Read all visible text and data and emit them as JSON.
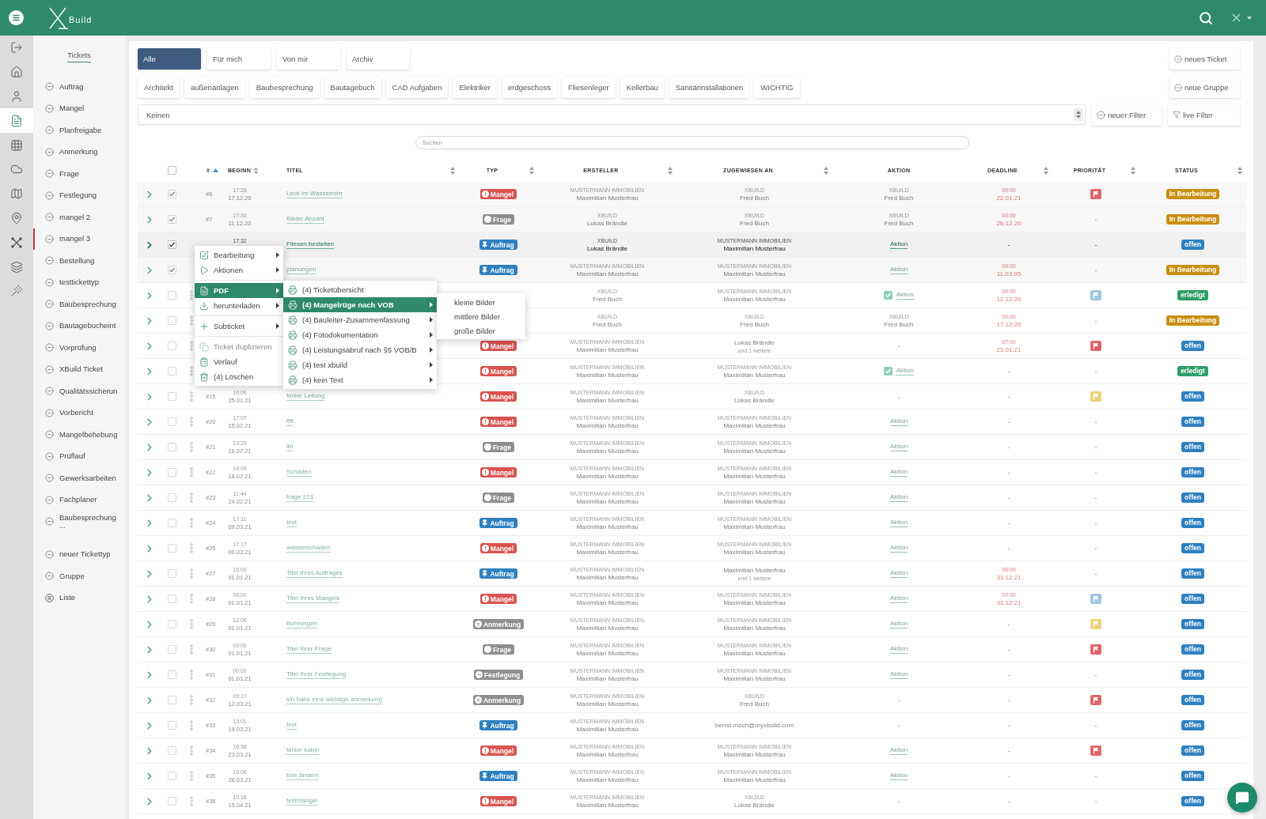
{
  "app_bar": {
    "brand": "Build"
  },
  "rail": [
    {
      "kind": "exit",
      "selected": false
    },
    {
      "kind": "home",
      "selected": false
    },
    {
      "kind": "user",
      "selected": false
    },
    {
      "kind": "document",
      "selected": true
    },
    {
      "kind": "grid",
      "selected": false
    },
    {
      "kind": "cloud",
      "selected": false
    },
    {
      "kind": "map",
      "selected": false
    },
    {
      "kind": "pin",
      "selected": false
    },
    {
      "kind": "network",
      "selected": false
    },
    {
      "kind": "layers",
      "selected": false
    },
    {
      "kind": "wand",
      "selected": false
    }
  ],
  "sidebar": {
    "title": "Tickets",
    "items": [
      {
        "label": "Auftrag",
        "selected": false
      },
      {
        "label": "Mangel",
        "selected": false
      },
      {
        "label": "Planfreigabe",
        "selected": false
      },
      {
        "label": "Anmerkung",
        "selected": false
      },
      {
        "label": "Frage",
        "selected": false
      },
      {
        "label": "Festlegung",
        "selected": false
      },
      {
        "label": "mangel 2",
        "selected": false
      },
      {
        "label": "mangel 3",
        "selected": true
      },
      {
        "label": "Bestellung",
        "selected": false
      },
      {
        "label": "testtickettyp",
        "selected": false
      },
      {
        "label": "Baubesprechung",
        "selected": false
      },
      {
        "label": "Bautagebucheint",
        "selected": false
      },
      {
        "label": "Vorprüfung",
        "selected": false
      },
      {
        "label": "XBuild Ticket",
        "selected": false
      },
      {
        "label": "Qualitätssicherun",
        "selected": false
      },
      {
        "label": "Vorbericht",
        "selected": false
      },
      {
        "label": "Mangelbehebung",
        "selected": false
      },
      {
        "label": "Prüflauf",
        "selected": false
      },
      {
        "label": "Gewerksarbeiten",
        "selected": false
      },
      {
        "label": "Fachplaner",
        "selected": false
      },
      {
        "label": "Baubesprechung ...",
        "selected": false
      }
    ],
    "actions": [
      {
        "label": "neuer Tickettyp",
        "kind": "add"
      },
      {
        "label": "Gruppe",
        "kind": "add"
      },
      {
        "label": "Liste",
        "kind": "list"
      }
    ]
  },
  "tabs": [
    {
      "label": "Alle",
      "selected": true
    },
    {
      "label": "Für mich",
      "selected": false
    },
    {
      "label": "Von mir",
      "selected": false
    },
    {
      "label": "Archiv",
      "selected": false
    }
  ],
  "new_ticket_button": {
    "label": "neues Ticket"
  },
  "groups": [
    "Architekt",
    "außenanlagen",
    "Baubesprechung",
    "Bautagebuch",
    "CAD Aufgaben",
    "Elektriker",
    "erdgeschoss",
    "Fliesenleger",
    "Kellerbau",
    "Sanitärinstallationen",
    "WICHTIG"
  ],
  "new_group_button": {
    "label": "neue Gruppe"
  },
  "filter": {
    "value": "Keinen"
  },
  "filter_buttons": [
    {
      "label": "neuer Filter",
      "kind": "add"
    },
    {
      "label": "live Filter",
      "kind": "filter"
    }
  ],
  "search": {
    "placeholder": "Suchen"
  },
  "table": {
    "select_all": {
      "checked": false
    },
    "columns": [
      {
        "label": "#",
        "sortable": true,
        "sorted": true
      },
      {
        "label": "BEGINN",
        "sortable": true,
        "sorted": false
      },
      {
        "label": "TITEL",
        "sortable": true,
        "sorted": false
      },
      {
        "label": "TYP",
        "sortable": true,
        "sorted": false
      },
      {
        "label": "ERSTELLER",
        "sortable": true,
        "sorted": false
      },
      {
        "label": "ZUGEWIESEN AN",
        "sortable": true,
        "sorted": false
      },
      {
        "label": "AKTION",
        "sortable": false,
        "sorted": false
      },
      {
        "label": "DEADLINE",
        "sortable": true,
        "sorted": false
      },
      {
        "label": "PRIORITÄT",
        "sortable": true,
        "sorted": false
      },
      {
        "label": "STATUS",
        "sortable": true,
        "sorted": false
      }
    ],
    "rows": [
      {
        "checked": true,
        "active": false,
        "number": "#6",
        "start": {
          "time": "17:26",
          "date": "17.12.20"
        },
        "title": "Leck im Wasserrohr",
        "type": {
          "label": "Mangel",
          "kind": "mangel"
        },
        "creator": {
          "org": "MUSTERMANN IMMOBILIEN",
          "name": "Maximilian Musterfrau"
        },
        "assignee": {
          "org": "XBUILD",
          "name": "Fred Buch"
        },
        "action": {
          "kind": "person",
          "org": "XBUILD",
          "name": "Fred Buch"
        },
        "deadline": {
          "time": "00:00",
          "date": "22.01.21"
        },
        "priority": {
          "kind": "flag",
          "color": "#e06666"
        },
        "status": {
          "label": "In Bearbeitung",
          "kind": "progress"
        }
      },
      {
        "checked": true,
        "active": false,
        "number": "#7",
        "start": {
          "time": "17:30",
          "date": "11.12.20"
        },
        "title": "Bäder Anzahl",
        "type": {
          "label": "Frage",
          "kind": "frage"
        },
        "creator": {
          "org": "XBUILD",
          "name": "Lukas Brändle"
        },
        "assignee": {
          "org": "XBUILD",
          "name": "Fred Buch"
        },
        "action": {
          "kind": "person",
          "org": "XBUILD",
          "name": "Fred Buch"
        },
        "deadline": {
          "time": "00:00",
          "date": "26.12.20"
        },
        "priority": {
          "kind": "none",
          "text": "-"
        },
        "status": {
          "label": "In Bearbeitung",
          "kind": "progress"
        }
      },
      {
        "checked": true,
        "active": true,
        "start": {
          "time": "17:32"
        },
        "title": "Fliesen bestellen",
        "type": {
          "label": "Auftrag",
          "kind": "auftrag"
        },
        "creator": {
          "org": "XBUILD",
          "name": "Lukas Brändle"
        },
        "assignee": {
          "org": "MUSTERMANN IMMOBILIEN",
          "name": "Maximilian Musterfrau"
        },
        "action": {
          "kind": "link",
          "text": "Aktion",
          "done": false
        },
        "deadline": {
          "text": "-"
        },
        "priority": {
          "kind": "none",
          "text": "-"
        },
        "status": {
          "label": "offen",
          "kind": "open"
        }
      },
      {
        "checked": true,
        "active": false,
        "title": "planungen",
        "type": {
          "label": "Auftrag",
          "kind": "auftrag"
        },
        "creator": {
          "org": "MUSTERMANN IMMOBILIEN",
          "name": "Maximilian Musterfrau"
        },
        "assignee": {
          "org": "MUSTERMANN IMMOBILIEN",
          "name": "Maximilian Musterfrau"
        },
        "action": {
          "kind": "link",
          "text": "Aktion",
          "done": false
        },
        "deadline": {
          "time": "09:00",
          "date": "11.03.95"
        },
        "priority": {
          "kind": "none",
          "text": "-"
        },
        "status": {
          "label": "In Bearbeitung",
          "kind": "progress"
        }
      },
      {
        "checked": false,
        "active": false,
        "creator": {
          "org": "XBUILD",
          "name": "Fred Buch"
        },
        "assignee": {
          "org": "MUSTERMANN IMMOBILIEN",
          "name": "Maximilian Musterfrau"
        },
        "action": {
          "kind": "link",
          "text": "Aktion",
          "done": true
        },
        "deadline": {
          "time": "00:00",
          "date": "12.12.20"
        },
        "priority": {
          "kind": "flag",
          "color": "#9fc8e3"
        },
        "status": {
          "label": "erledigt",
          "kind": "done"
        }
      },
      {
        "checked": false,
        "active": false,
        "creator": {
          "org": "XBUILD",
          "name": "Fred Buch"
        },
        "assignee": {
          "org": "XBUILD",
          "name": "Fred Buch"
        },
        "action": {
          "kind": "person",
          "org": "XBUILD",
          "name": "Fred Buch"
        },
        "deadline": {
          "time": "00:00",
          "date": "17.12.20"
        },
        "priority": {
          "kind": "none",
          "text": "-"
        },
        "status": {
          "label": "In Bearbeitung",
          "kind": "progress"
        }
      },
      {
        "checked": false,
        "active": false,
        "type": {
          "label": "Mangel",
          "kind": "mangel"
        },
        "creator": {
          "org": "MUSTERMANN IMMOBILIEN",
          "name": "Maximilian Musterfrau"
        },
        "assignee": {
          "name": "Lukas Brändle",
          "more": "und 1 weitere"
        },
        "action": {
          "kind": "dash",
          "text": "-"
        },
        "deadline": {
          "time": "07:00",
          "date": "23.01.21"
        },
        "priority": {
          "kind": "flag",
          "color": "#e06666"
        },
        "status": {
          "label": "offen",
          "kind": "open"
        }
      },
      {
        "checked": false,
        "active": false,
        "type": {
          "label": "Mangel",
          "kind": "mangel"
        },
        "creator": {
          "org": "MUSTERMANN IMMOBILIEN",
          "name": "Maximilian Musterfrau"
        },
        "assignee": {
          "org": "MUSTERMANN IMMOBILIEN",
          "name": "Maximilian Musterfrau"
        },
        "action": {
          "kind": "link",
          "text": "Aktion",
          "done": true
        },
        "deadline": {
          "text": "-"
        },
        "priority": {
          "kind": "none",
          "text": "-"
        },
        "status": {
          "label": "erledigt",
          "kind": "done"
        }
      },
      {
        "checked": false,
        "active": false,
        "number": "#15",
        "start": {
          "time": "16:06",
          "date": "25.01.21"
        },
        "title": "fehler Leitung",
        "type": {
          "label": "Mangel",
          "kind": "mangel"
        },
        "creator": {
          "org": "MUSTERMANN IMMOBILIEN",
          "name": "Maximilian Musterfrau"
        },
        "assignee": {
          "org": "XBUILD",
          "name": "Lukas Brändle"
        },
        "action": {
          "kind": "dash",
          "text": "-"
        },
        "deadline": {
          "text": "-"
        },
        "priority": {
          "kind": "flag",
          "color": "#f0d27e"
        },
        "status": {
          "label": "offen",
          "kind": "open"
        }
      },
      {
        "checked": false,
        "active": false,
        "number": "#20",
        "start": {
          "time": "17:07",
          "date": "15.02.21"
        },
        "title": "ffff",
        "type": {
          "label": "Mangel",
          "kind": "mangel"
        },
        "creator": {
          "org": "MUSTERMANN IMMOBILIEN",
          "name": "Maximilian Musterfrau"
        },
        "assignee": {
          "org": "MUSTERMANN IMMOBILIEN",
          "name": "Maximilian Musterfrau"
        },
        "action": {
          "kind": "link",
          "text": "Aktion",
          "done": false
        },
        "deadline": {
          "text": "-"
        },
        "priority": {
          "kind": "none",
          "text": "-"
        },
        "status": {
          "label": "offen",
          "kind": "open"
        }
      },
      {
        "checked": false,
        "active": false,
        "number": "#21",
        "start": {
          "time": "13:29",
          "date": "16.02.21"
        },
        "title": "lhi",
        "type": {
          "label": "Frage",
          "kind": "frage"
        },
        "creator": {
          "org": "MUSTERMANN IMMOBILIEN",
          "name": "Maximilian Musterfrau"
        },
        "assignee": {
          "org": "MUSTERMANN IMMOBILIEN",
          "name": "Maximilian Musterfrau"
        },
        "action": {
          "kind": "link",
          "text": "Aktion",
          "done": false
        },
        "deadline": {
          "text": "-"
        },
        "priority": {
          "kind": "none",
          "text": "-"
        },
        "status": {
          "label": "offen",
          "kind": "open"
        }
      },
      {
        "checked": false,
        "active": false,
        "number": "#22",
        "start": {
          "time": "14:09",
          "date": "18.02.21"
        },
        "title": "Schaden",
        "type": {
          "label": "Mangel",
          "kind": "mangel"
        },
        "creator": {
          "org": "MUSTERMANN IMMOBILIEN",
          "name": "Maximilian Musterfrau"
        },
        "assignee": {
          "org": "MUSTERMANN IMMOBILIEN",
          "name": "Maximilian Musterfrau"
        },
        "action": {
          "kind": "link",
          "text": "Aktion",
          "done": false
        },
        "deadline": {
          "text": "-"
        },
        "priority": {
          "kind": "none",
          "text": "-"
        },
        "status": {
          "label": "offen",
          "kind": "open"
        }
      },
      {
        "checked": false,
        "active": false,
        "number": "#23",
        "start": {
          "time": "11:44",
          "date": "24.02.21"
        },
        "title": "frage 123",
        "type": {
          "label": "Frage",
          "kind": "frage"
        },
        "creator": {
          "org": "MUSTERMANN IMMOBILIEN",
          "name": "Maximilian Musterfrau"
        },
        "assignee": {
          "org": "MUSTERMANN IMMOBILIEN",
          "name": "Maximilian Musterfrau"
        },
        "action": {
          "kind": "link",
          "text": "Aktion",
          "done": false
        },
        "deadline": {
          "text": "-"
        },
        "priority": {
          "kind": "none",
          "text": "-"
        },
        "status": {
          "label": "offen",
          "kind": "open"
        }
      },
      {
        "checked": false,
        "active": false,
        "number": "#24",
        "start": {
          "time": "17:11",
          "date": "09.03.21"
        },
        "title": "test",
        "type": {
          "label": "Auftrag",
          "kind": "auftrag"
        },
        "creator": {
          "org": "MUSTERMANN IMMOBILIEN",
          "name": "Maximilian Musterfrau"
        },
        "assignee": {
          "org": "MUSTERMANN IMMOBILIEN",
          "name": "Maximilian Musterfrau"
        },
        "action": {
          "kind": "link",
          "text": "Aktion",
          "done": false
        },
        "deadline": {
          "text": "-"
        },
        "priority": {
          "kind": "none",
          "text": "-"
        },
        "status": {
          "label": "offen",
          "kind": "open"
        }
      },
      {
        "checked": false,
        "active": false,
        "number": "#25",
        "start": {
          "time": "17:17",
          "date": "09.03.21"
        },
        "title": "wasserschaden",
        "type": {
          "label": "Mangel",
          "kind": "mangel"
        },
        "creator": {
          "org": "MUSTERMANN IMMOBILIEN",
          "name": "Maximilian Musterfrau"
        },
        "assignee": {
          "org": "MUSTERMANN IMMOBILIEN",
          "name": "Maximilian Musterfrau"
        },
        "action": {
          "kind": "link",
          "text": "Aktion",
          "done": false
        },
        "deadline": {
          "text": "-"
        },
        "priority": {
          "kind": "none",
          "text": "-"
        },
        "status": {
          "label": "offen",
          "kind": "open"
        }
      },
      {
        "checked": false,
        "active": false,
        "number": "#27",
        "start": {
          "time": "16:00",
          "date": "01.01.21"
        },
        "title": "Titel Ihres Auftrages",
        "type": {
          "label": "Auftrag",
          "kind": "auftrag"
        },
        "creator": {
          "org": "MUSTERMANN IMMOBILIEN",
          "name": "Maximilian Musterfrau"
        },
        "assignee": {
          "name": "Maximilian Musterfrau",
          "more": "und 1 weitere"
        },
        "action": {
          "kind": "link",
          "text": "Aktion",
          "done": false
        },
        "deadline": {
          "time": "08:00",
          "date": "31.12.21"
        },
        "priority": {
          "kind": "none",
          "text": "-"
        },
        "status": {
          "label": "offen",
          "kind": "open"
        }
      },
      {
        "checked": false,
        "active": false,
        "number": "#28",
        "start": {
          "time": "08:00",
          "date": "01.01.21"
        },
        "title": "Titel Ihres Mangels",
        "type": {
          "label": "Mangel",
          "kind": "mangel"
        },
        "creator": {
          "org": "MUSTERMANN IMMOBILIEN",
          "name": "Maximilian Musterfrau"
        },
        "assignee": {
          "org": "MUSTERMANN IMMOBILIEN",
          "name": "Maximilian Musterfrau"
        },
        "action": {
          "kind": "link",
          "text": "Aktion",
          "done": false
        },
        "deadline": {
          "time": "00:00",
          "date": "31.12.21"
        },
        "priority": {
          "kind": "flag",
          "color": "#9fc8e3"
        },
        "status": {
          "label": "offen",
          "kind": "open"
        }
      },
      {
        "checked": false,
        "active": false,
        "number": "#29",
        "start": {
          "time": "12:00",
          "date": "01.01.21"
        },
        "title": "Bohrungen",
        "type": {
          "label": "Anmerkung",
          "kind": "anmerkung"
        },
        "creator": {
          "org": "MUSTERMANN IMMOBILIEN",
          "name": "Maximilian Musterfrau"
        },
        "assignee": {
          "org": "MUSTERMANN IMMOBILIEN",
          "name": "Maximilian Musterfrau"
        },
        "action": {
          "kind": "link",
          "text": "Aktion",
          "done": false
        },
        "deadline": {
          "text": "-"
        },
        "priority": {
          "kind": "flag",
          "color": "#f0d27e"
        },
        "status": {
          "label": "offen",
          "kind": "open"
        }
      },
      {
        "checked": false,
        "active": false,
        "number": "#30",
        "start": {
          "time": "09:00",
          "date": "01.01.21"
        },
        "title": "Titel Ihrer Frage",
        "type": {
          "label": "Frage",
          "kind": "frage"
        },
        "creator": {
          "org": "MUSTERMANN IMMOBILIEN",
          "name": "Maximilian Musterfrau"
        },
        "assignee": {
          "org": "MUSTERMANN IMMOBILIEN",
          "name": "Maximilian Musterfrau"
        },
        "action": {
          "kind": "link",
          "text": "Aktion",
          "done": false
        },
        "deadline": {
          "text": "-"
        },
        "priority": {
          "kind": "flag",
          "color": "#e06666"
        },
        "status": {
          "label": "offen",
          "kind": "open"
        }
      },
      {
        "checked": false,
        "active": false,
        "number": "#31",
        "start": {
          "time": "00:00",
          "date": "01.01.21"
        },
        "title": "Titel Ihrer Festlegung",
        "type": {
          "label": "Festlegung",
          "kind": "festlegung"
        },
        "creator": {
          "org": "MUSTERMANN IMMOBILIEN",
          "name": "Maximilian Musterfrau"
        },
        "assignee": {
          "org": "MUSTERMANN IMMOBILIEN",
          "name": "Maximilian Musterfrau"
        },
        "action": {
          "kind": "link",
          "text": "Aktion",
          "done": false
        },
        "deadline": {
          "text": "-"
        },
        "priority": {
          "kind": "none",
          "text": "-"
        },
        "status": {
          "label": "offen",
          "kind": "open"
        }
      },
      {
        "checked": false,
        "active": false,
        "number": "#32",
        "start": {
          "time": "09:17",
          "date": "12.03.21"
        },
        "title": "ich habe eine wichtige anmerkung",
        "type": {
          "label": "Anmerkung",
          "kind": "anmerkung"
        },
        "creator": {
          "org": "MUSTERMANN IMMOBILIEN",
          "name": "Maximilian Musterfrau"
        },
        "assignee": {
          "org": "XBUILD",
          "name": "Fred Buch"
        },
        "action": {
          "kind": "dash",
          "text": "-"
        },
        "deadline": {
          "text": "-"
        },
        "priority": {
          "kind": "flag",
          "color": "#e06666"
        },
        "status": {
          "label": "offen",
          "kind": "open"
        }
      },
      {
        "checked": false,
        "active": false,
        "number": "#33",
        "start": {
          "time": "13:01",
          "date": "19.03.21"
        },
        "title": "test",
        "type": {
          "label": "Auftrag",
          "kind": "auftrag"
        },
        "creator": {
          "org": "MUSTERMANN IMMOBILIEN",
          "name": "Maximilian Musterfrau"
        },
        "assignee": {
          "name": "bernd.moch@myxbuild.com"
        },
        "action": {
          "kind": "dash",
          "text": "-"
        },
        "deadline": {
          "text": "-"
        },
        "priority": {
          "kind": "none",
          "text": "-"
        },
        "status": {
          "label": "offen",
          "kind": "open"
        }
      },
      {
        "checked": false,
        "active": false,
        "number": "#34",
        "start": {
          "time": "16:38",
          "date": "23.03.21"
        },
        "title": "fehler kabel",
        "type": {
          "label": "Mangel",
          "kind": "mangel"
        },
        "creator": {
          "org": "MUSTERMANN IMMOBILIEN",
          "name": "Maximilian Musterfrau"
        },
        "assignee": {
          "org": "MUSTERMANN IMMOBILIEN",
          "name": "Maximilian Musterfrau"
        },
        "action": {
          "kind": "link",
          "text": "Aktion",
          "done": false
        },
        "deadline": {
          "text": "-"
        },
        "priority": {
          "kind": "flag",
          "color": "#e06666"
        },
        "status": {
          "label": "offen",
          "kind": "open"
        }
      },
      {
        "checked": false,
        "active": false,
        "number": "#35",
        "start": {
          "time": "13:06",
          "date": "26.03.21"
        },
        "title": "türe ändern",
        "type": {
          "label": "Auftrag",
          "kind": "auftrag"
        },
        "creator": {
          "org": "MUSTERMANN IMMOBILIEN",
          "name": "Maximilian Musterfrau"
        },
        "assignee": {
          "org": "MUSTERMANN IMMOBILIEN",
          "name": "Maximilian Musterfrau"
        },
        "action": {
          "kind": "link",
          "text": "Aktion",
          "done": false
        },
        "deadline": {
          "text": "-"
        },
        "priority": {
          "kind": "none",
          "text": "-"
        },
        "status": {
          "label": "offen",
          "kind": "open"
        }
      },
      {
        "checked": false,
        "active": false,
        "number": "#36",
        "start": {
          "time": "10:18",
          "date": "15.04.21"
        },
        "title": "testmangel",
        "type": {
          "label": "Mangel",
          "kind": "mangel"
        },
        "creator": {
          "org": "MUSTERMANN IMMOBILIEN",
          "name": "Maximilian Musterfrau"
        },
        "assignee": {
          "org": "XBUILD",
          "name": "Lukas Brändle"
        },
        "action": {
          "kind": "dash",
          "text": "-"
        },
        "deadline": {
          "text": "-"
        },
        "priority": {
          "kind": "none",
          "text": "-"
        },
        "status": {
          "label": "offen",
          "kind": "open"
        }
      }
    ]
  },
  "context_menu": {
    "groups": [
      {
        "items": [
          {
            "label": "Bearbeitung",
            "kind": "edit",
            "submenu": true,
            "selected": false,
            "disabled": false
          },
          {
            "label": "Aktionen",
            "kind": "play",
            "submenu": true,
            "selected": false,
            "disabled": false
          }
        ]
      },
      {
        "items": [
          {
            "label": "PDF",
            "kind": "pdf",
            "submenu": true,
            "selected": true,
            "disabled": false
          },
          {
            "label": "herunterladen",
            "kind": "download",
            "submenu": true,
            "selected": false,
            "disabled": false
          }
        ]
      },
      {
        "items": [
          {
            "label": "Subticket",
            "kind": "plus",
            "submenu": true,
            "selected": false,
            "disabled": false
          }
        ]
      },
      {
        "items": [
          {
            "label": "Ticket duplizieren",
            "kind": "copy",
            "submenu": false,
            "selected": false,
            "disabled": true
          },
          {
            "label": "Verlauf",
            "kind": "history",
            "submenu": false,
            "selected": false,
            "disabled": false
          },
          {
            "label": "(4) Löschen",
            "kind": "trash",
            "submenu": false,
            "selected": false,
            "disabled": false
          }
        ]
      }
    ],
    "pdf_menu": {
      "items": [
        {
          "label": "(4) Ticketübersicht",
          "submenu": false,
          "selected": false
        },
        {
          "label": "(4) Mangelrüge nach VOB",
          "submenu": true,
          "selected": true
        },
        {
          "label": "(4) Bauleiter-Zusammenfassung",
          "submenu": true,
          "selected": false
        },
        {
          "label": "(4) Fotodokumentation",
          "submenu": true,
          "selected": false
        },
        {
          "label": "(4) Leistungsabruf nach §5 VOB/B",
          "submenu": true,
          "selected": false
        },
        {
          "label": "(4) test xbuild",
          "submenu": true,
          "selected": false
        },
        {
          "label": "(4) kein Text",
          "submenu": true,
          "selected": false
        }
      ]
    },
    "image_menu": {
      "items": [
        "kleine Bilder",
        "mittlere Bilder",
        "große Bilder"
      ]
    }
  }
}
